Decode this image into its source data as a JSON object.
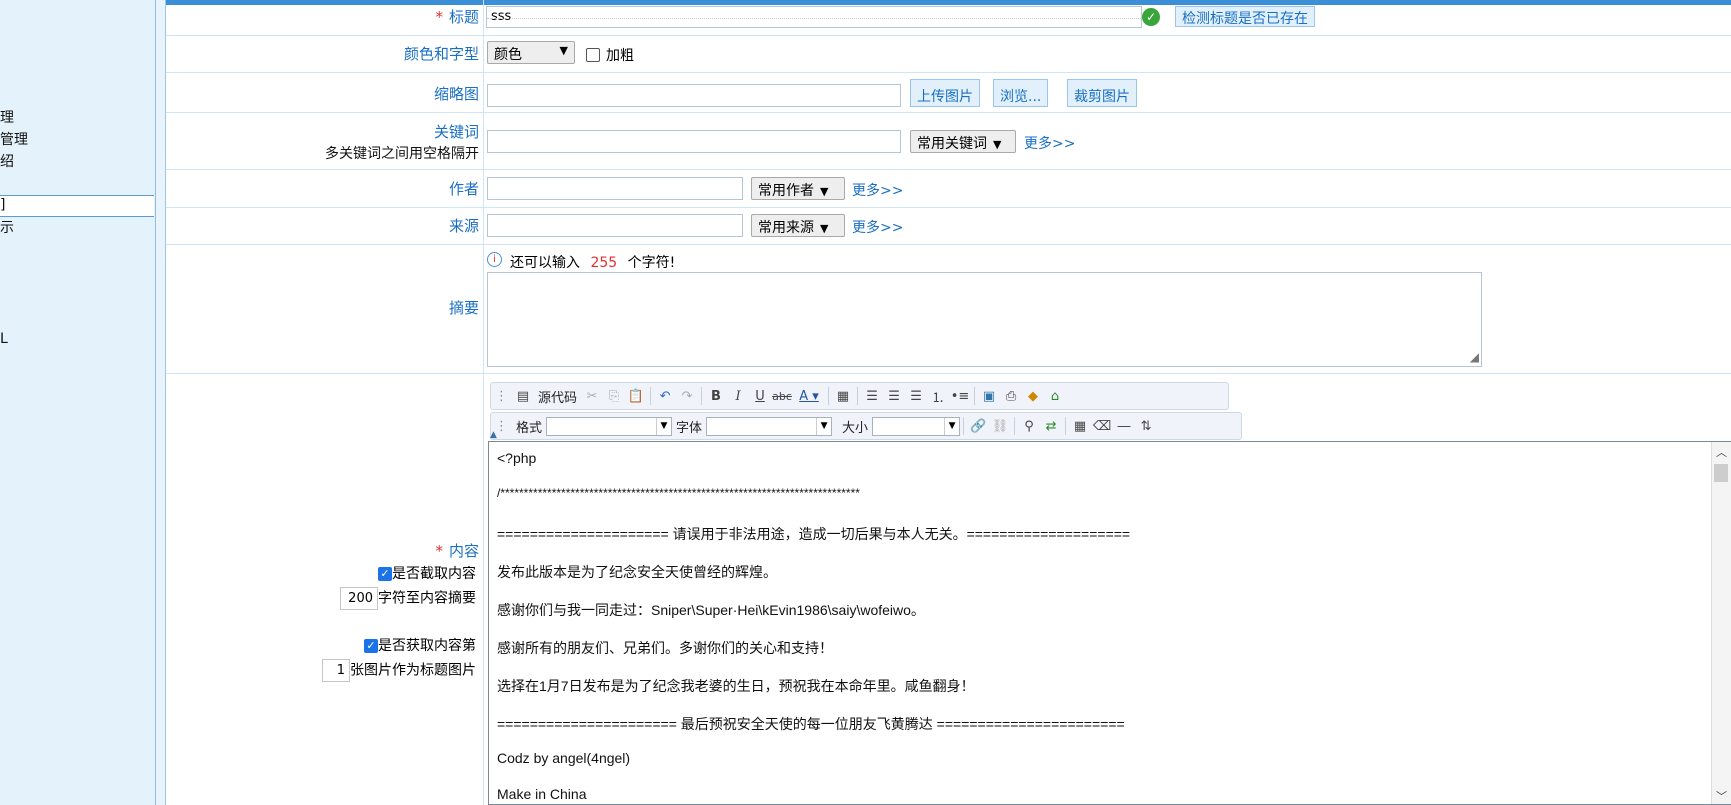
{
  "left_nav": {
    "items": [
      "理",
      "管理",
      "绍",
      "]",
      "示",
      "L"
    ]
  },
  "form": {
    "title_label": "标题",
    "title_required": "*",
    "title_value": "sss",
    "check_title_button": "检测标题是否已存在",
    "color_font_label": "颜色和字型",
    "color_select": "颜色",
    "bold_label": "加粗",
    "thumbnail_label": "缩略图",
    "upload_button": "上传图片",
    "browse_button": "浏览...",
    "crop_button": "裁剪图片",
    "keywords_label": "关键词",
    "keywords_hint": "多关键词之间用空格隔开",
    "keywords_select": "常用关键词",
    "more_link": "更多>>",
    "author_label": "作者",
    "author_select": "常用作者",
    "source_label": "来源",
    "source_select": "常用来源",
    "summary_label": "摘要",
    "summary_hint_prefix": "还可以输入",
    "summary_remaining": "255",
    "summary_hint_suffix": "个字符!",
    "content_label": "内容",
    "content_required": "*",
    "extract_summary_label": "是否截取内容",
    "extract_chars_value": "200",
    "extract_chars_suffix": "字符至内容摘要",
    "fetch_image_label": "是否获取内容第",
    "fetch_image_index": "1",
    "fetch_image_suffix": "张图片作为标题图片"
  },
  "editor_toolbar": {
    "source_button": "源代码",
    "format_label": "格式",
    "font_label": "字体",
    "size_label": "大小"
  },
  "editor_content": {
    "lines": [
      "<?php",
      "/*****************************************************************************",
      "===================== 请误用于非法用途，造成一切后果与本人无关。====================",
      "发布此版本是为了纪念安全天使曾经的辉煌。",
      "感谢你们与我一同走过：Sniper\\Super·Hei\\kEvin1986\\saiy\\wofeiwo。",
      "感谢所有的朋友们、兄弟们。多谢你们的关心和支持！",
      "选择在1月7日发布是为了纪念我老婆的生日，预祝我在本命年里。咸鱼翻身！",
      "====================== 最后预祝安全天使的每一位朋友飞黄腾达 =======================",
      "Codz by angel(4ngel)",
      "Make in China"
    ]
  },
  "colors": {
    "accent": "#1a6fc4",
    "required": "#e03030",
    "nav_bg": "#e4f2fc"
  }
}
